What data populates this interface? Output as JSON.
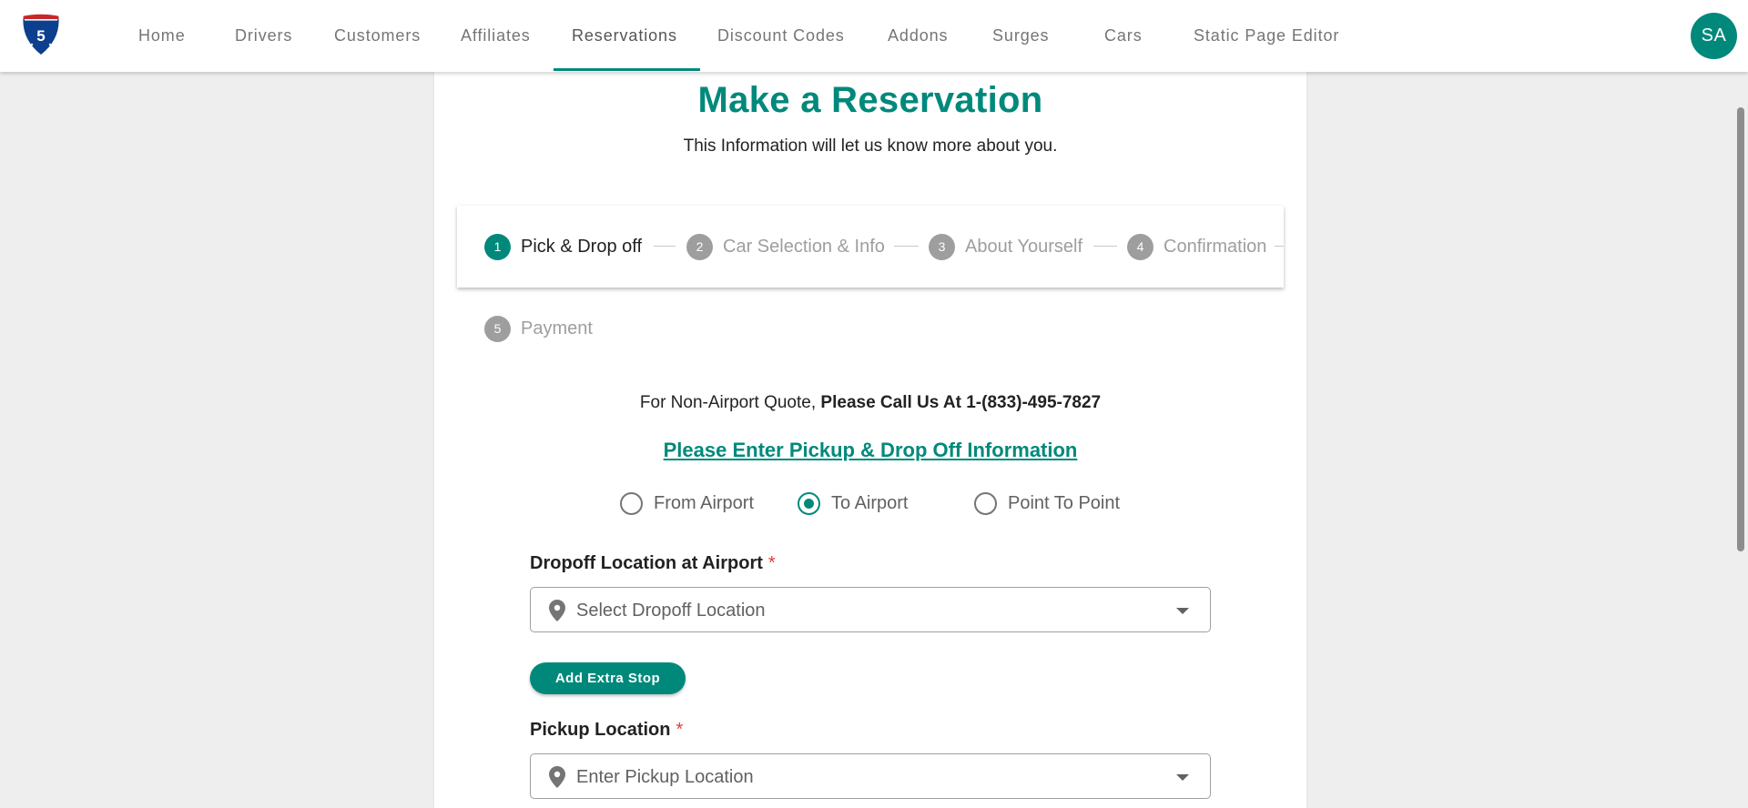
{
  "nav": {
    "items": [
      {
        "label": "Home"
      },
      {
        "label": "Drivers"
      },
      {
        "label": "Customers"
      },
      {
        "label": "Affiliates"
      },
      {
        "label": "Reservations"
      },
      {
        "label": "Discount Codes"
      },
      {
        "label": "Addons"
      },
      {
        "label": "Surges"
      },
      {
        "label": "Cars"
      },
      {
        "label": "Static Page Editor"
      }
    ],
    "active": "Reservations",
    "avatar": "SA"
  },
  "logo": {
    "icon": "interstate-shield-icon",
    "colors": {
      "top": "#c62828",
      "bottom": "#0d3f8f"
    }
  },
  "page": {
    "title": "Make a Reservation",
    "subtitle": "This Information will let us know more about you."
  },
  "stepper": {
    "steps": [
      {
        "number": "1",
        "label": "Pick & Drop off",
        "active": true
      },
      {
        "number": "2",
        "label": "Car Selection & Info",
        "active": false
      },
      {
        "number": "3",
        "label": "About Yourself",
        "active": false
      },
      {
        "number": "4",
        "label": "Confirmation",
        "active": false
      },
      {
        "number": "5",
        "label": "Payment",
        "active": false
      }
    ]
  },
  "quote": {
    "prefix": "For Non-Airport Quote, ",
    "bold": "Please Call Us At 1-(833)-495-7827"
  },
  "form": {
    "heading": "Please Enter Pickup & Drop Off Information",
    "trip_types": [
      {
        "label": "From Airport",
        "checked": false
      },
      {
        "label": "To Airport",
        "checked": true
      },
      {
        "label": "Point To Point",
        "checked": false
      }
    ],
    "dropoff": {
      "label": "Dropoff Location at Airport",
      "required_mark": "*",
      "placeholder": "Select Dropoff Location",
      "icon": "location-pin-icon"
    },
    "extra_stop_label": "Add Extra Stop",
    "pickup": {
      "label": "Pickup Location",
      "required_mark": "*",
      "placeholder": "Enter Pickup Location",
      "icon": "location-pin-icon"
    }
  },
  "colors": {
    "accent": "#00897b",
    "required": "#e53935",
    "background": "#eeeeee"
  }
}
